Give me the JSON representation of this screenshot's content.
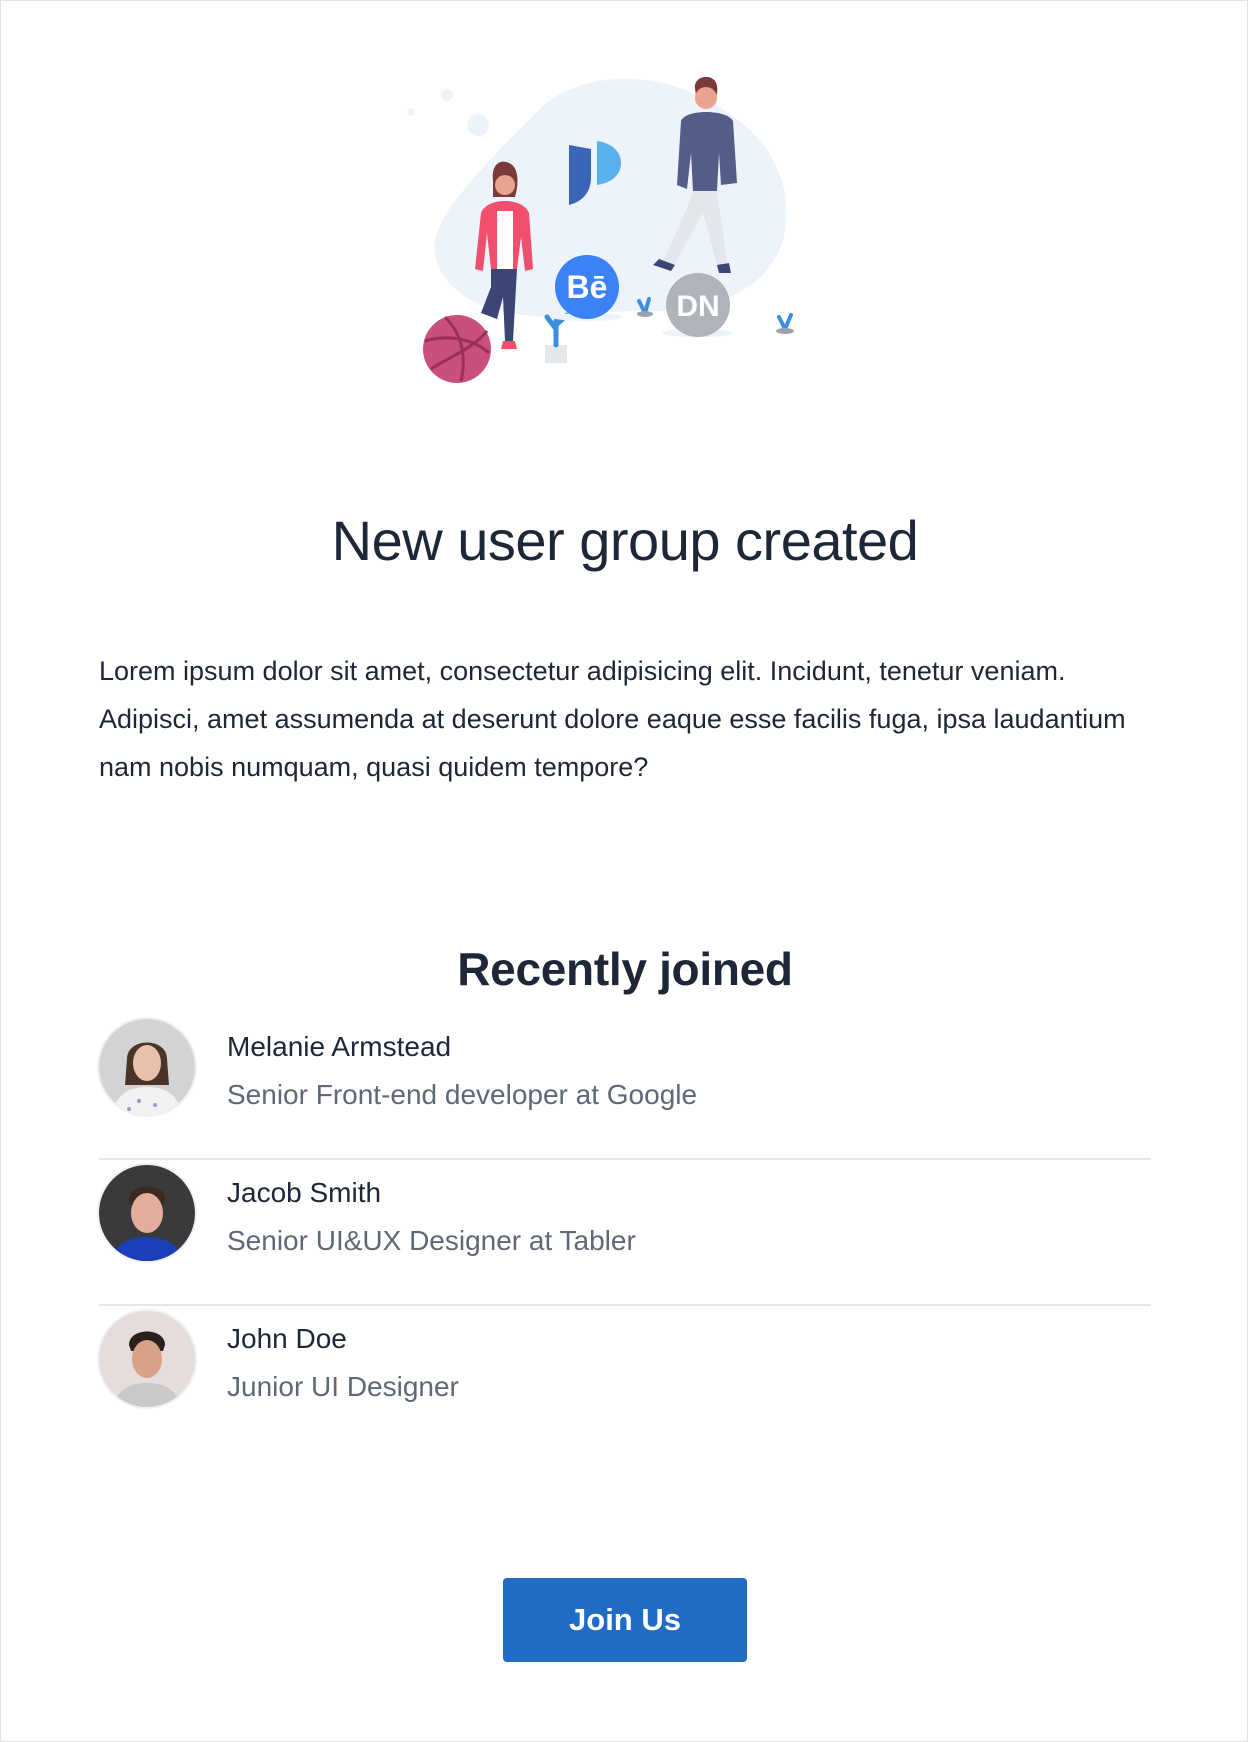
{
  "email": {
    "title": "New user group created",
    "body": "Lorem ipsum dolor sit amet, consectetur adipisicing elit. Incidunt, tenetur veniam. Adipisci, amet assumenda at deserunt dolore eaque esse facilis fuga, ipsa laudantium nam nobis numquam, quasi quidem tempore?",
    "recent_title": "Recently joined",
    "members": [
      {
        "name": "Melanie Armstead",
        "role": "Senior Front-end developer at Google",
        "avatar": "woman-avatar"
      },
      {
        "name": "Jacob Smith",
        "role": "Senior UI&UX Designer at Tabler",
        "avatar": "man-avatar"
      },
      {
        "name": "John Doe",
        "role": "Junior UI Designer",
        "avatar": "man-avatar"
      }
    ],
    "cta_label": "Join Us"
  },
  "illustration": {
    "badge_behance": "Bē",
    "badge_dn": "DN",
    "icons": [
      "basketball-icon",
      "behance-icon",
      "designer-news-icon",
      "tabler-logo-icon",
      "plant-icon"
    ]
  },
  "colors": {
    "primary": "#206bc4",
    "text": "#1d2738",
    "muted": "#5f6877",
    "border": "#e3e7ec"
  }
}
